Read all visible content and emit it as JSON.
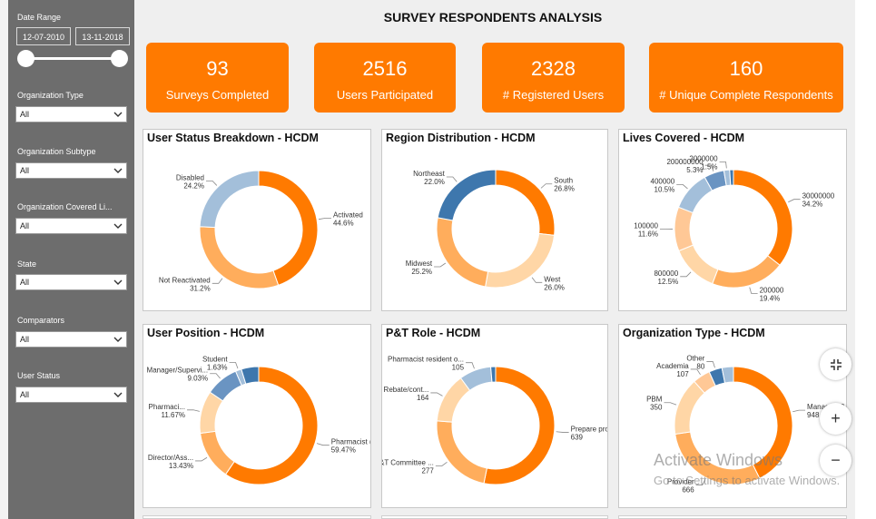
{
  "title": "SURVEY RESPONDENTS ANALYSIS",
  "filters": {
    "date_range_label": "Date Range",
    "date_start": "12-07-2010",
    "date_end": "13-11-2018",
    "dropdowns": [
      {
        "label": "Organization Type",
        "value": "All"
      },
      {
        "label": "Organization Subtype",
        "value": "All"
      },
      {
        "label": "Organization Covered Li...",
        "value": "All"
      },
      {
        "label": "State",
        "value": "All"
      },
      {
        "label": "Comparators",
        "value": "All"
      },
      {
        "label": "User Status",
        "value": "All"
      }
    ]
  },
  "kpis": [
    {
      "value": "93",
      "label": "Surveys Completed"
    },
    {
      "value": "2516",
      "label": "Users Participated"
    },
    {
      "value": "2328",
      "label": "# Registered Users"
    },
    {
      "value": "160",
      "label": "# Unique Complete Respondents"
    }
  ],
  "colors": {
    "kpi_orange": "#ff7a00",
    "sidebar": "#6d6d6d",
    "orange": "#ff7a00",
    "light_orange": "#ffad5c",
    "peach": "#ffd6a6",
    "light_blue": "#a3bfda",
    "mid_blue": "#6a94c2",
    "dark_blue": "#3e77ad"
  },
  "chart_data": [
    {
      "type": "pie",
      "title": "User Status Breakdown - HCDM",
      "slices": [
        {
          "name": "Activated",
          "value": 44.6,
          "label": "44.6%",
          "color": "#ff7a00"
        },
        {
          "name": "Not Reactivated",
          "value": 31.2,
          "label": "31.2%",
          "color": "#ffad5c"
        },
        {
          "name": "Disabled",
          "value": 24.2,
          "label": "24.2%",
          "color": "#a3bfda"
        }
      ]
    },
    {
      "type": "pie",
      "title": "Region Distribution - HCDM",
      "slices": [
        {
          "name": "South",
          "value": 26.8,
          "label": "26.8%",
          "color": "#ff7a00"
        },
        {
          "name": "West",
          "value": 26.0,
          "label": "26.0%",
          "color": "#ffd6a6"
        },
        {
          "name": "Midwest",
          "value": 25.2,
          "label": "25.2%",
          "color": "#ffad5c"
        },
        {
          "name": "Northeast",
          "value": 22.0,
          "label": "22.0%",
          "color": "#3e77ad"
        }
      ]
    },
    {
      "type": "pie",
      "title": "Lives Covered - HCDM",
      "slices": [
        {
          "name": "30000000",
          "value": 34.2,
          "label": "34.2%",
          "color": "#ff7a00"
        },
        {
          "name": "200000",
          "value": 19.4,
          "label": "19.4%",
          "color": "#ffad5c"
        },
        {
          "name": "800000",
          "value": 12.5,
          "label": "12.5%",
          "color": "#ffd6a6"
        },
        {
          "name": "100000",
          "value": 11.6,
          "label": "11.6%",
          "color": "#ffc896"
        },
        {
          "name": "400000",
          "value": 10.5,
          "label": "10.5%",
          "color": "#a3bfda"
        },
        {
          "name": "200000000",
          "value": 5.3,
          "label": "5.3%",
          "color": "#6a94c2"
        },
        {
          "name": "2000000",
          "value": 1.5,
          "label": "1.5%",
          "color": "#a3bfda"
        },
        {
          "name": "",
          "value": 1.0,
          "label": "",
          "color": "#3e77ad"
        }
      ]
    },
    {
      "type": "pie",
      "title": "User Position - HCDM",
      "slices": [
        {
          "name": "Pharmacist (Clinical...",
          "value": 59.47,
          "label": "59.47%",
          "color": "#ff7a00"
        },
        {
          "name": "Director/Ass...",
          "value": 13.43,
          "label": "13.43%",
          "color": "#ffad5c"
        },
        {
          "name": "Pharmaci...",
          "value": 11.67,
          "label": "11.67%",
          "color": "#ffd6a6"
        },
        {
          "name": "Manager/Supervi...",
          "value": 9.03,
          "label": "9.03%",
          "color": "#6a94c2"
        },
        {
          "name": "Student",
          "value": 1.63,
          "label": "1.63%",
          "color": "#a3bfda"
        },
        {
          "name": "",
          "value": 4.77,
          "label": "",
          "color": "#3e77ad"
        }
      ]
    },
    {
      "type": "pie",
      "title": "P&T Role - HCDM",
      "slices": [
        {
          "name": "Prepare produc...",
          "value": 639,
          "label": "639",
          "color": "#ff7a00"
        },
        {
          "name": "P&T Committee ...",
          "value": 277,
          "label": "277",
          "color": "#ffad5c"
        },
        {
          "name": "Rebate/cont...",
          "value": 164,
          "label": "164",
          "color": "#ffd6a6"
        },
        {
          "name": "Pharmacist resident o...",
          "value": 105,
          "label": "105",
          "color": "#a3bfda"
        },
        {
          "name": "",
          "value": 16,
          "label": "",
          "color": "#3e77ad"
        }
      ]
    },
    {
      "type": "pie",
      "title": "Organization Type - HCDM",
      "slices": [
        {
          "name": "Managed C...",
          "value": 948,
          "label": "948",
          "color": "#ff7a00"
        },
        {
          "name": "Provider",
          "value": 666,
          "label": "666",
          "color": "#ffad5c"
        },
        {
          "name": "PBM",
          "value": 350,
          "label": "350",
          "color": "#ffd6a6"
        },
        {
          "name": "Academia",
          "value": 107,
          "label": "107",
          "color": "#ffc896"
        },
        {
          "name": "Other",
          "value": 80,
          "label": "80",
          "color": "#3e77ad"
        },
        {
          "name": "",
          "value": 70,
          "label": "",
          "color": "#a3bfda"
        }
      ]
    }
  ],
  "zoom": {
    "fit": "fit-to-page",
    "in": "+",
    "out": "−"
  },
  "watermark": {
    "line1": "Activate Windows",
    "line2": "Go to Settings to activate Windows."
  }
}
